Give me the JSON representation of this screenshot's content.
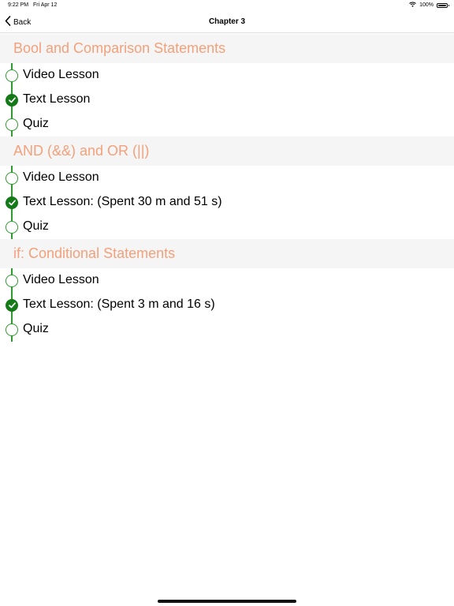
{
  "status": {
    "time": "9:22 PM",
    "date": "Fri Apr 12",
    "battery": "100%",
    "battery_level": 1.0
  },
  "nav": {
    "back_label": "Back",
    "title": "Chapter 3"
  },
  "colors": {
    "accent": "#f4a07a",
    "timeline": "#2e9b2e",
    "done": "#137a17",
    "section_bg": "#f5f5f5"
  },
  "sections": [
    {
      "title": "Bool and Comparison Statements",
      "items": [
        {
          "label": "Video Lesson",
          "completed": false
        },
        {
          "label": "Text Lesson",
          "completed": true
        },
        {
          "label": "Quiz",
          "completed": false
        }
      ]
    },
    {
      "title": "AND (&&) and OR (||)",
      "items": [
        {
          "label": "Video Lesson",
          "completed": false
        },
        {
          "label": "Text Lesson: (Spent 30 m and 51 s)",
          "completed": true
        },
        {
          "label": "Quiz",
          "completed": false
        }
      ]
    },
    {
      "title": "if: Conditional Statements",
      "items": [
        {
          "label": "Video Lesson",
          "completed": false
        },
        {
          "label": "Text Lesson: (Spent 3 m and 16 s)",
          "completed": true
        },
        {
          "label": "Quiz",
          "completed": false
        }
      ]
    }
  ]
}
